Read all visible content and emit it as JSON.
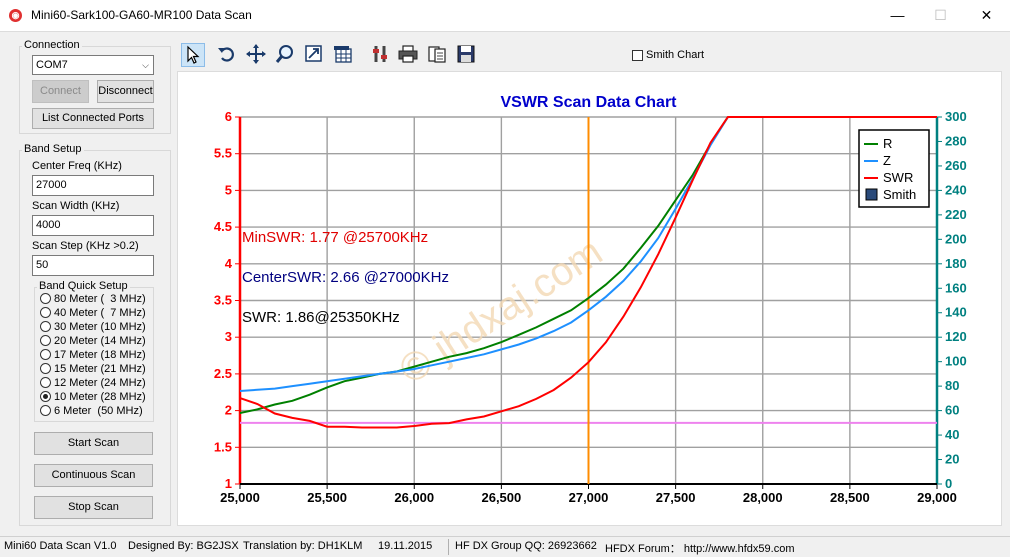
{
  "window": {
    "title": "Mini60-Sark100-GA60-MR100 Data Scan",
    "minimize": "—",
    "maximize": "☐",
    "close": "✕"
  },
  "connection": {
    "group_label": "Connection",
    "port_value": "COM7",
    "connect_label": "Connect",
    "disconnect_label": "Disconnect",
    "list_ports_label": "List Connected Ports"
  },
  "band_setup": {
    "group_label": "Band Setup",
    "center_freq_label": "Center Freq  (KHz)",
    "center_freq_value": "27000",
    "scan_width_label": "Scan Width   (KHz)",
    "scan_width_value": "4000",
    "scan_step_label": "Scan Step    (KHz >0.2)",
    "scan_step_value": "50",
    "quick_setup_label": "Band Quick Setup",
    "bands": [
      {
        "label": "80 Meter (  3 MHz)",
        "checked": false
      },
      {
        "label": "40 Meter (  7 MHz)",
        "checked": false
      },
      {
        "label": "30 Meter (10 MHz)",
        "checked": false
      },
      {
        "label": "20 Meter (14 MHz)",
        "checked": false
      },
      {
        "label": "17 Meter (18 MHz)",
        "checked": false
      },
      {
        "label": "15 Meter (21 MHz)",
        "checked": false
      },
      {
        "label": "12 Meter (24 MHz)",
        "checked": false
      },
      {
        "label": "10 Meter (28 MHz)",
        "checked": true
      },
      {
        "label": "6 Meter  (50 MHz)",
        "checked": false
      }
    ],
    "start_scan_label": "Start Scan",
    "continuous_scan_label": "Continuous Scan",
    "stop_scan_label": "Stop Scan"
  },
  "toolbar": {
    "tools": [
      "pointer-icon",
      "undo-icon",
      "pan-icon",
      "zoom-icon",
      "zoom-fit-icon",
      "data-table-icon",
      "settings-icon",
      "print-icon",
      "export-icon",
      "save-icon"
    ],
    "smith_chart_label": "Smith Chart"
  },
  "chart_data": {
    "type": "line",
    "title": "VSWR Scan Data Chart",
    "xlim": [
      25000,
      29000
    ],
    "x_ticks": [
      "25,000",
      "25,500",
      "26,000",
      "26,500",
      "27,000",
      "27,500",
      "28,000",
      "28,500",
      "29,000"
    ],
    "ylim_left": [
      1,
      6
    ],
    "y_left_ticks": [
      "1",
      "1.5",
      "2",
      "2.5",
      "3",
      "3.5",
      "4",
      "4.5",
      "5",
      "5.5",
      "6"
    ],
    "ylim_right": [
      0,
      300
    ],
    "y_right_ticks": [
      "0",
      "20",
      "40",
      "60",
      "80",
      "100",
      "120",
      "140",
      "160",
      "180",
      "200",
      "220",
      "240",
      "260",
      "280",
      "300"
    ],
    "center_marker_x": 27000,
    "reference_line_ohms": 50,
    "legend": [
      "R",
      "Z",
      "SWR",
      "Smith"
    ],
    "legend_position": "top-right",
    "annotations": [
      {
        "text": "MinSWR: 1.77 @25700KHz",
        "color": "#e00000"
      },
      {
        "text": "CenterSWR: 2.66 @27000KHz",
        "color": "#000080"
      },
      {
        "text": "SWR: 1.86@25350KHz",
        "color": "#000000"
      }
    ],
    "watermark": "© jhdxaj.com",
    "colors": {
      "R": "#008000",
      "Z": "#1e90ff",
      "SWR": "#ff0000",
      "marker": "#ff8c00",
      "ref": "#ee82ee",
      "left_axis": "#ff0000",
      "right_axis": "#008080",
      "title": "#0000cc"
    },
    "series": [
      {
        "name": "R",
        "axis": "right",
        "x": [
          25000,
          25100,
          25200,
          25300,
          25400,
          25500,
          25600,
          25700,
          25800,
          25900,
          26000,
          26100,
          26200,
          26300,
          26400,
          26500,
          26600,
          26700,
          26800,
          26900,
          27000,
          27100,
          27200,
          27300,
          27400,
          27500,
          27600,
          27700,
          27800
        ],
        "y": [
          58,
          61,
          65,
          68,
          73,
          79,
          84,
          87,
          90,
          92,
          96,
          100,
          104,
          107,
          111,
          116,
          122,
          128,
          135,
          142,
          152,
          163,
          176,
          193,
          211,
          232,
          253,
          278,
          300
        ]
      },
      {
        "name": "Z",
        "axis": "right",
        "x": [
          25000,
          25100,
          25200,
          25300,
          25400,
          25500,
          25600,
          25700,
          25800,
          25900,
          26000,
          26100,
          26200,
          26300,
          26400,
          26500,
          26600,
          26700,
          26800,
          26900,
          27000,
          27100,
          27200,
          27300,
          27400,
          27500,
          27600,
          27700,
          27800
        ],
        "y": [
          76,
          77,
          78,
          80,
          82,
          84,
          86,
          88,
          90,
          92,
          94,
          97,
          100,
          103,
          106,
          110,
          114,
          119,
          125,
          132,
          142,
          153,
          166,
          182,
          201,
          225,
          250,
          277,
          300
        ]
      },
      {
        "name": "SWR",
        "axis": "left",
        "x": [
          25000,
          25100,
          25200,
          25300,
          25400,
          25500,
          25600,
          25700,
          25800,
          25900,
          26000,
          26100,
          26200,
          26300,
          26400,
          26500,
          26600,
          26700,
          26800,
          26900,
          27000,
          27100,
          27200,
          27300,
          27400,
          27500,
          27600,
          27700,
          27800,
          29000
        ],
        "y": [
          2.17,
          2.09,
          1.96,
          1.9,
          1.86,
          1.78,
          1.78,
          1.77,
          1.77,
          1.77,
          1.79,
          1.82,
          1.83,
          1.88,
          1.92,
          1.99,
          2.06,
          2.16,
          2.28,
          2.45,
          2.66,
          2.93,
          3.28,
          3.68,
          4.13,
          4.63,
          5.15,
          5.65,
          6.0,
          6.0
        ]
      }
    ]
  },
  "status": {
    "version": "Mini60 Data Scan V1.0",
    "designer": "Designed By: BG2JSX",
    "translation": "Translation by: DH1KLM",
    "date": "19.11.2015",
    "group": "HF DX Group QQ: 26923662",
    "forum": "HFDX Forum：  http://www.hfdx59.com"
  }
}
